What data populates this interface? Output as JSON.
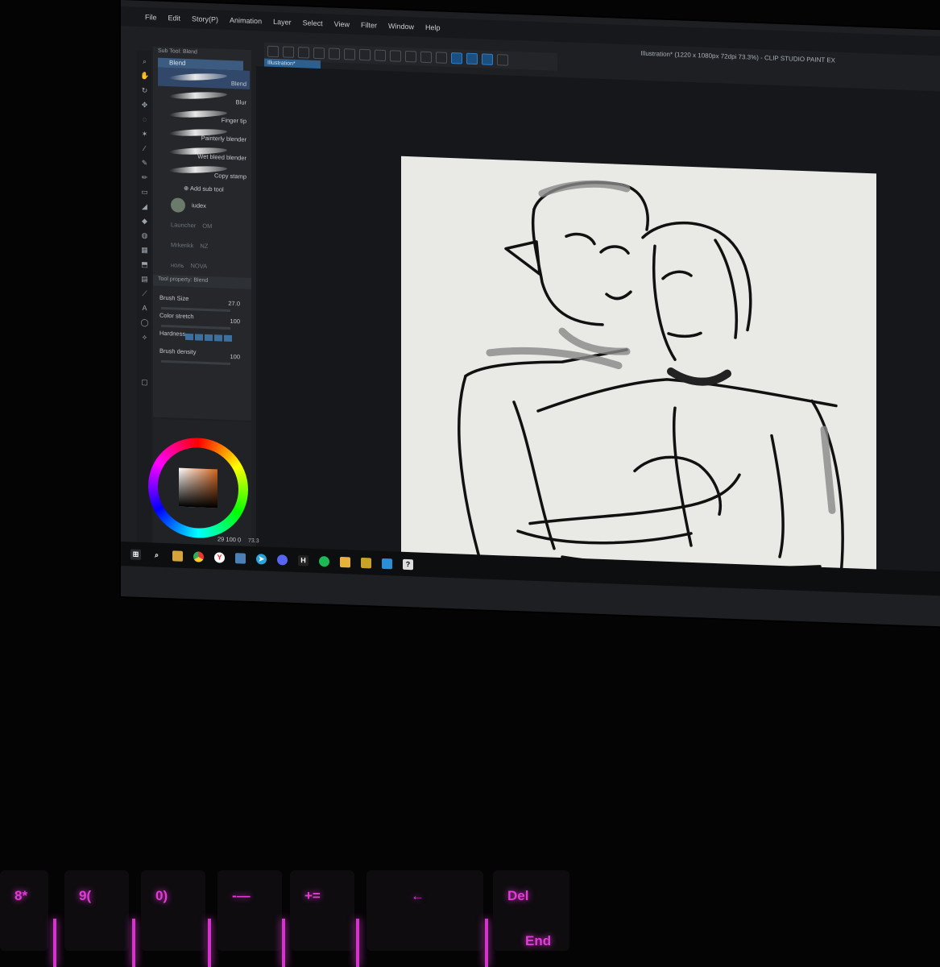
{
  "menu": [
    "File",
    "Edit",
    "Story(P)",
    "Animation",
    "Layer",
    "Select",
    "View",
    "Filter",
    "Window",
    "Help"
  ],
  "app_title": "Illustration* (1220 x 1080px 72dpi 73.3%) - CLIP STUDIO PAINT EX",
  "document_tab": "Illustration*",
  "sub_tool": {
    "header": "Sub Tool: Blend",
    "group": "Blend",
    "items": [
      "Blend",
      "Blur",
      "Finger tip",
      "Painterly blender",
      "Wet bleed blender",
      "Copy stamp"
    ],
    "selected": "Blend",
    "add_label": "Add sub tool"
  },
  "sidebar_rows": [
    {
      "label": "iudex"
    },
    {
      "label": "Launcher",
      "tag": "OM"
    },
    {
      "label": "Mrkerikk",
      "tag": "NZ"
    },
    {
      "label": "ноль",
      "tag": "NOVA"
    }
  ],
  "tool_property": {
    "header": "Tool property: Blend",
    "brush_size_label": "Brush Size",
    "brush_size_value": "27.0",
    "color_stretch_label": "Color stretch",
    "color_stretch_value": "100",
    "hardness_label": "Hardness",
    "brush_density_label": "Brush density",
    "brush_density_value": "100"
  },
  "color_readout": "29 100 0",
  "zoom": "73.3",
  "colors": {
    "accent": "#2c5e8e",
    "canvas": "#e9e9e6",
    "keyboard_glow": "#e33ad8"
  },
  "taskbar_icons": [
    "windows-icon",
    "search-icon",
    "folder-icon",
    "chrome-icon",
    "yandex-icon",
    "photos-icon",
    "telegram-icon",
    "discord-icon",
    "h-icon",
    "spotify-icon",
    "app-icon",
    "app-icon",
    "app-icon",
    "clip-studio-icon"
  ],
  "keys": [
    "8*",
    "9(",
    "0)",
    "-—",
    "+=",
    "←",
    "Del",
    "End"
  ]
}
